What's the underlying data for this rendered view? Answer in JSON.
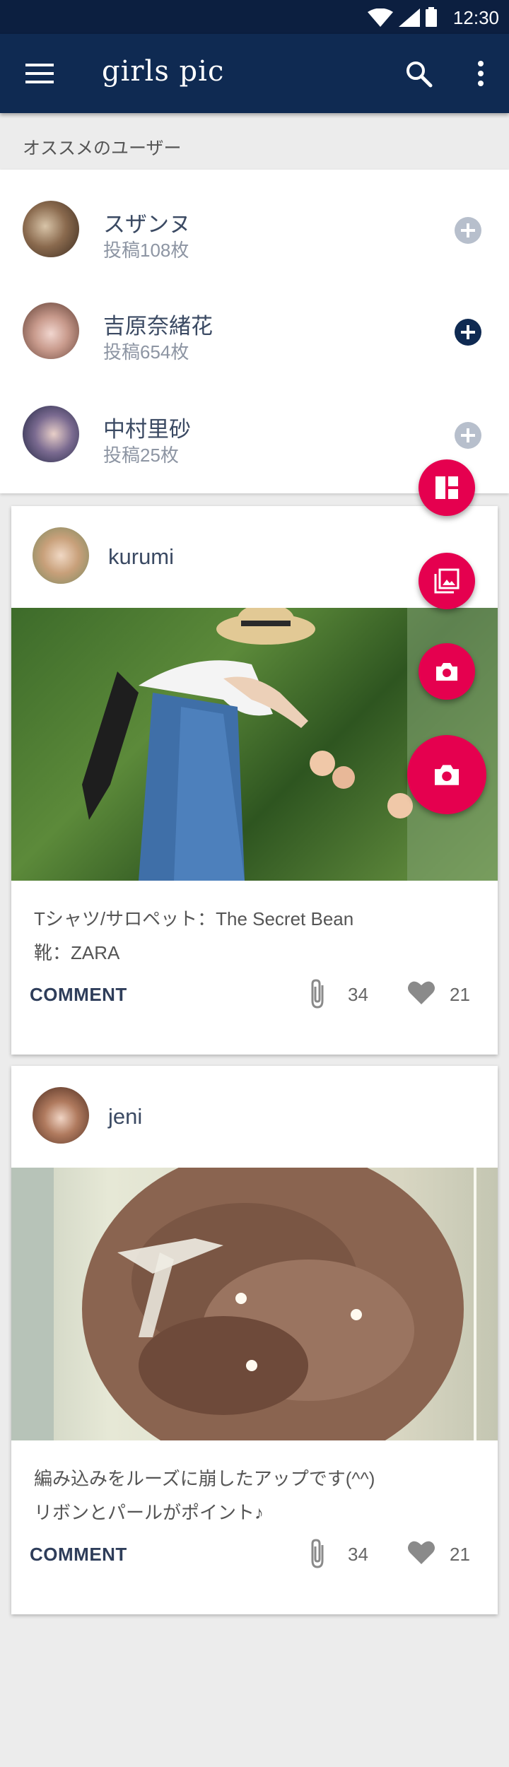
{
  "status": {
    "time": "12:30"
  },
  "appbar": {
    "title": "girls pic",
    "menu_icon": "menu-icon",
    "search_icon": "search-icon",
    "more_icon": "more-vert-icon"
  },
  "recommend": {
    "label": "オススメのユーザー",
    "users": [
      {
        "name": "スザンヌ",
        "posts": "投稿108枚",
        "followed": false
      },
      {
        "name": "吉原奈緒花",
        "posts": "投稿654枚",
        "followed": true
      },
      {
        "name": "中村里砂",
        "posts": "投稿25枚",
        "followed": false
      }
    ]
  },
  "posts": [
    {
      "user": "kurumi",
      "desc_line1": "Tシャツ/サロペット：The Secret Bean",
      "desc_line2": "靴：ZARA",
      "comment_label": "COMMENT",
      "clips": "34",
      "likes": "21"
    },
    {
      "user": "jeni",
      "desc_line1": "編み込みをルーズに崩したアップです(^^)",
      "desc_line2": "リボンとパールがポイント♪",
      "comment_label": "COMMENT",
      "clips": "34",
      "likes": "21"
    }
  ],
  "fab": {
    "items": [
      "dashboard-icon",
      "photo-library-icon",
      "camera-icon"
    ],
    "main": "camera-icon"
  },
  "colors": {
    "primary": "#0f2a52",
    "accent": "#e5004f",
    "status_bar": "#0c1f40"
  }
}
